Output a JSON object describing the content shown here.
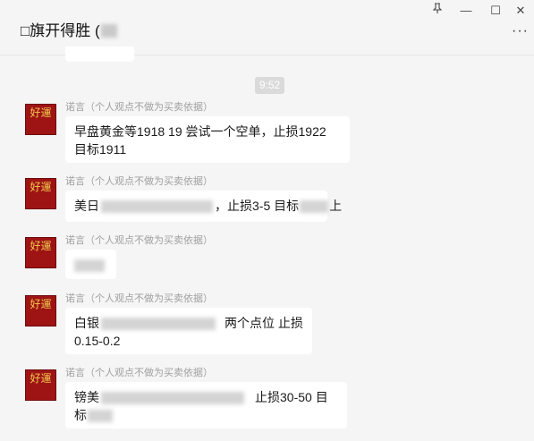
{
  "window": {
    "title": "□旗开得胜 (",
    "pin_icon": "pin-icon",
    "minimize_glyph": "—",
    "maximize_glyph": "☐",
    "close_glyph": "✕",
    "more_glyph": "···"
  },
  "timestamp": "9:52",
  "avatar_text": "好運",
  "messages": [
    {
      "sender": "诺言（个人观点不做为买卖依据）",
      "line1": "早盘黄金等1918   19  尝试一个空单，止损1922",
      "line2": "目标1911"
    },
    {
      "sender": "诺言（个人观点不做为买卖依据）",
      "seg1": "美日",
      "seg2": "，止损3-5   目标",
      "seg3": "上"
    },
    {
      "sender": "诺言（个人观点不做为买卖依据）"
    },
    {
      "sender": "诺言（个人观点不做为买卖依据）",
      "seg1": "白银",
      "seg2": "两个点位  止损",
      "line2": "0.15-0.2"
    },
    {
      "sender": "诺言（个人观点不做为买卖依据）",
      "seg1": "镑美",
      "seg2": "止损30-50    目",
      "line2": "标"
    }
  ],
  "colors": {
    "background": "#f5f5f5",
    "bubble": "#ffffff",
    "avatar_bg": "#9e1414",
    "avatar_text": "#f1c94e",
    "sender_text": "#a0a0a0",
    "time_pill": "#dadada"
  }
}
